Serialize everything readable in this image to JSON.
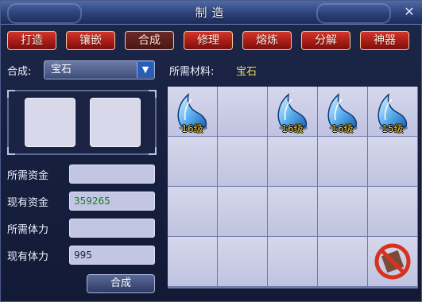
{
  "window": {
    "title": "制造",
    "close_icon": "close-icon"
  },
  "tabs": [
    {
      "label": "打造",
      "active": false
    },
    {
      "label": "镶嵌",
      "active": false
    },
    {
      "label": "合成",
      "active": true
    },
    {
      "label": "修理",
      "active": false
    },
    {
      "label": "熔炼",
      "active": false
    },
    {
      "label": "分解",
      "active": false
    },
    {
      "label": "神器",
      "active": false
    }
  ],
  "compose": {
    "label": "合成:",
    "selected": "宝石"
  },
  "materials": {
    "label": "所需材料:",
    "value": "宝石"
  },
  "fields": {
    "required_funds_label": "所需资金",
    "required_funds": "",
    "current_funds_label": "现有资金",
    "current_funds": "359265",
    "required_stamina_label": "所需体力",
    "required_stamina": "",
    "current_stamina_label": "现有体力",
    "current_stamina": "995"
  },
  "buttons": {
    "compose": "合成"
  },
  "inventory": {
    "cells": [
      {
        "item": "gem",
        "level": "16级"
      },
      {
        "item": "",
        "level": ""
      },
      {
        "item": "gem",
        "level": "16级"
      },
      {
        "item": "gem",
        "level": "16级"
      },
      {
        "item": "gem",
        "level": "15级"
      },
      {
        "item": "",
        "level": ""
      },
      {
        "item": "",
        "level": ""
      },
      {
        "item": "",
        "level": ""
      },
      {
        "item": "",
        "level": ""
      },
      {
        "item": "",
        "level": ""
      },
      {
        "item": "",
        "level": ""
      },
      {
        "item": "",
        "level": ""
      },
      {
        "item": "",
        "level": ""
      },
      {
        "item": "",
        "level": ""
      },
      {
        "item": "",
        "level": ""
      },
      {
        "item": "",
        "level": ""
      },
      {
        "item": "",
        "level": ""
      },
      {
        "item": "",
        "level": ""
      },
      {
        "item": "",
        "level": ""
      },
      {
        "item": "forbidden-icon",
        "level": ""
      }
    ]
  },
  "colors": {
    "tab_red": "#c0281f",
    "label_yellow": "#f2d95a",
    "funds_green": "#1a7a2a"
  }
}
